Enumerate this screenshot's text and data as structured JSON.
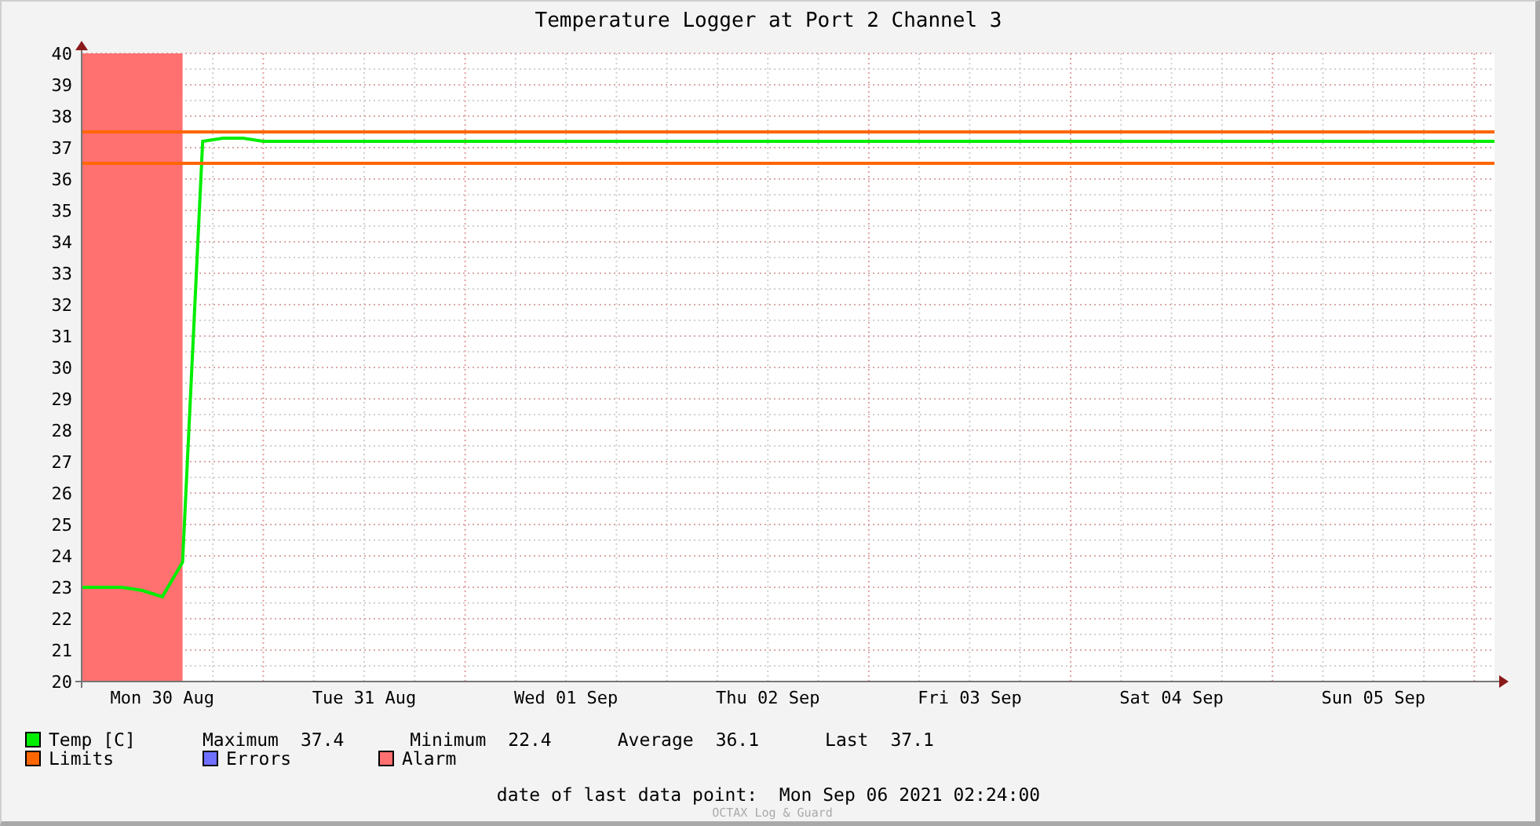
{
  "chart": {
    "chart_data": {
      "type": "line",
      "title": "Temperature Logger at Port 2 Channel 3",
      "categories": [
        null,
        null,
        null,
        null,
        "Mon 30 Aug",
        null,
        null,
        null,
        null,
        null,
        null,
        null,
        null,
        null,
        "Tue 31 Aug",
        null,
        null,
        null,
        null,
        null,
        null,
        null,
        null,
        null,
        "Wed 01 Sep",
        null,
        null,
        null,
        null,
        null,
        null,
        null,
        null,
        null,
        "Thu 02 Sep",
        null,
        null,
        null,
        null,
        null,
        null,
        null,
        null,
        null,
        "Fri 03 Sep",
        null,
        null,
        null,
        null,
        null,
        null,
        null,
        null,
        null,
        "Sat 04 Sep",
        null,
        null,
        null,
        null,
        null,
        null,
        null,
        null,
        null,
        "Sun 05 Sep",
        null,
        null,
        null,
        null,
        null,
        null
      ],
      "ylim": [
        20,
        40
      ],
      "grid": true,
      "yticks": [
        20,
        21,
        22,
        23,
        24,
        25,
        26,
        27,
        28,
        29,
        30,
        31,
        32,
        33,
        34,
        35,
        36,
        37,
        38,
        39,
        40
      ],
      "series": [
        {
          "name": "Alarm",
          "type": "area",
          "color": "#ff7070",
          "values": [
            40,
            40,
            40,
            40,
            40,
            40,
            null,
            null,
            null,
            null,
            null,
            null,
            null,
            null,
            null,
            null,
            null,
            null,
            null,
            null,
            null,
            null,
            null,
            null,
            null,
            null,
            null,
            null,
            null,
            null,
            null,
            null,
            null,
            null,
            null,
            null,
            null,
            null,
            null,
            null,
            null,
            null,
            null,
            null,
            null,
            null,
            null,
            null,
            null,
            null,
            null,
            null,
            null,
            null,
            null,
            null,
            null,
            null,
            null,
            null,
            null,
            null,
            null,
            null,
            null,
            null,
            null,
            null,
            null,
            null,
            null
          ]
        },
        {
          "name": "Temp [C]",
          "color": "#00ee00",
          "values": [
            23,
            23,
            23,
            22.9,
            22.7,
            23.8,
            37.2,
            37.3,
            37.3,
            37.2,
            37.2,
            37.2,
            37.2,
            37.2,
            37.2,
            37.2,
            37.2,
            37.2,
            37.2,
            37.2,
            37.2,
            37.2,
            37.2,
            37.2,
            37.2,
            37.2,
            37.2,
            37.2,
            37.2,
            37.2,
            37.2,
            37.2,
            37.2,
            37.2,
            37.2,
            37.2,
            37.2,
            37.2,
            37.2,
            37.2,
            37.2,
            37.2,
            37.2,
            37.2,
            37.2,
            37.2,
            37.2,
            37.2,
            37.2,
            37.2,
            37.2,
            37.2,
            37.2,
            37.2,
            37.2,
            37.2,
            37.2,
            37.2,
            37.2,
            37.2,
            37.2,
            37.2,
            37.2,
            37.2,
            37.2,
            37.2,
            37.2,
            37.2,
            37.2,
            37.2,
            37.2
          ]
        }
      ],
      "ref_lines": [
        {
          "axis": "y",
          "value": 37.5,
          "color": "#ff6600"
        },
        {
          "axis": "y",
          "value": 36.5,
          "color": "#ff6600"
        }
      ]
    }
  },
  "legend": [
    {
      "kind": "series",
      "stats": [
        {
          "label": "Maximum",
          "value": "37.4"
        },
        {
          "label": "Minimum",
          "value": "22.4"
        },
        {
          "label": "Average",
          "value": "36.1"
        },
        {
          "label": "Last",
          "value": "37.1"
        }
      ]
    },
    {
      "kind": "swatch",
      "label": "Limits",
      "color": "#ff6600"
    },
    {
      "kind": "swatch",
      "label": "Errors",
      "color": "#7070ff"
    },
    {
      "kind": "series"
    }
  ],
  "last_data_point": {
    "label": "date of last data point:",
    "value": "Mon Sep 06 2021 02:24:00"
  },
  "watermark": "OCTAX Log & Guard"
}
